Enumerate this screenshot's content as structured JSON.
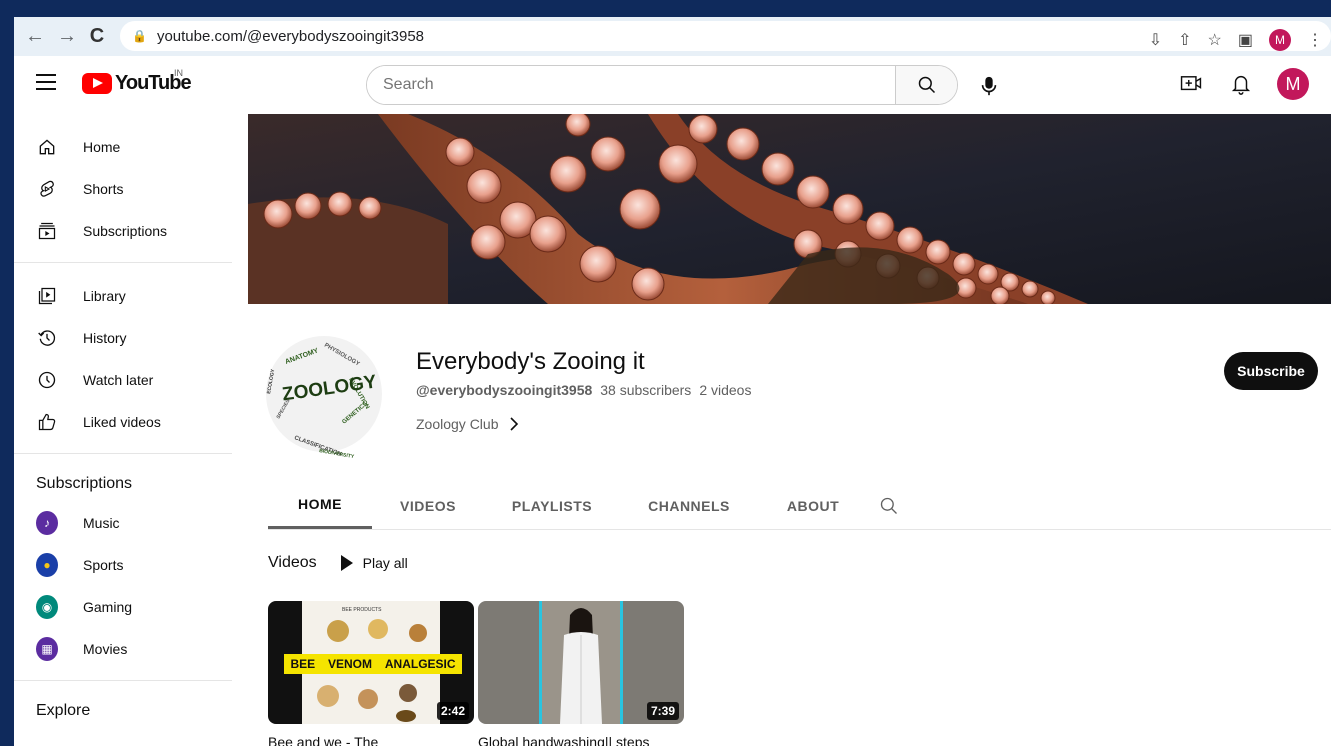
{
  "browser": {
    "url": "youtube.com/@everybodyszooingit3958",
    "avatar_letter": "M"
  },
  "masthead": {
    "logo_text": "YouTube",
    "country": "IN",
    "search_placeholder": "Search",
    "avatar_letter": "M",
    "avatar_color": "#c2185b"
  },
  "sidebar": {
    "main": [
      {
        "label": "Home",
        "icon": "home-icon"
      },
      {
        "label": "Shorts",
        "icon": "shorts-icon"
      },
      {
        "label": "Subscriptions",
        "icon": "subscriptions-icon"
      }
    ],
    "you": [
      {
        "label": "Library",
        "icon": "library-icon"
      },
      {
        "label": "History",
        "icon": "history-icon"
      },
      {
        "label": "Watch later",
        "icon": "clock-icon"
      },
      {
        "label": "Liked videos",
        "icon": "thumbs-up-icon"
      }
    ],
    "subscriptions_heading": "Subscriptions",
    "subscriptions": [
      {
        "label": "Music",
        "color": "#5b2ca0"
      },
      {
        "label": "Sports",
        "color": "#1a3fa8"
      },
      {
        "label": "Gaming",
        "color": "#00897b"
      },
      {
        "label": "Movies",
        "color": "#5b2ca0"
      }
    ],
    "explore_heading": "Explore"
  },
  "channel": {
    "name": "Everybody's Zooing it",
    "handle": "@everybodyszooingit3958",
    "subscribers": "38 subscribers",
    "videos_count": "2 videos",
    "link_label": "Zoology Club",
    "subscribe_label": "Subscribe",
    "avatar_text": "ZOOLOGY"
  },
  "tabs": [
    "HOME",
    "VIDEOS",
    "PLAYLISTS",
    "CHANNELS",
    "ABOUT"
  ],
  "active_tab": "HOME",
  "videos_section": {
    "title": "Videos",
    "play_all": "Play all",
    "items": [
      {
        "title": "Bee and we - The",
        "duration": "2:42",
        "thumb_text_1": "BEE",
        "thumb_text_2": "VENOM",
        "thumb_text_3": "ANALGESIC",
        "thumb_caption": "BEE PRODUCTS"
      },
      {
        "title": "Global handwashing|| steps",
        "duration": "7:39"
      }
    ]
  }
}
